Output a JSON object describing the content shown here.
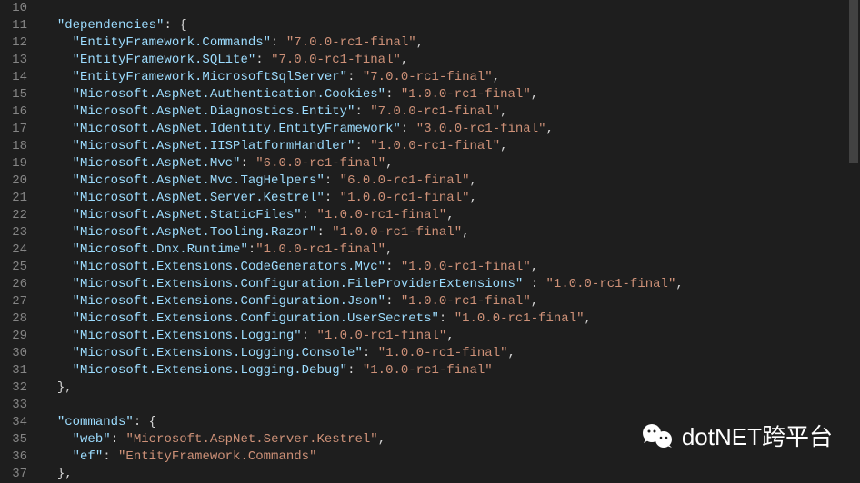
{
  "startLine": 10,
  "lines": [
    {
      "indent": 0,
      "tokens": []
    },
    {
      "indent": 1,
      "tokens": [
        {
          "t": "key",
          "v": "\"dependencies\""
        },
        {
          "t": "punctuation",
          "v": ": {"
        }
      ]
    },
    {
      "indent": 2,
      "tokens": [
        {
          "t": "key",
          "v": "\"EntityFramework.Commands\""
        },
        {
          "t": "punctuation",
          "v": ": "
        },
        {
          "t": "string",
          "v": "\"7.0.0-rc1-final\""
        },
        {
          "t": "punctuation",
          "v": ","
        }
      ]
    },
    {
      "indent": 2,
      "tokens": [
        {
          "t": "key",
          "v": "\"EntityFramework.SQLite\""
        },
        {
          "t": "punctuation",
          "v": ": "
        },
        {
          "t": "string",
          "v": "\"7.0.0-rc1-final\""
        },
        {
          "t": "punctuation",
          "v": ","
        }
      ]
    },
    {
      "indent": 2,
      "tokens": [
        {
          "t": "key",
          "v": "\"EntityFramework.MicrosoftSqlServer\""
        },
        {
          "t": "punctuation",
          "v": ": "
        },
        {
          "t": "string",
          "v": "\"7.0.0-rc1-final\""
        },
        {
          "t": "punctuation",
          "v": ","
        }
      ]
    },
    {
      "indent": 2,
      "tokens": [
        {
          "t": "key",
          "v": "\"Microsoft.AspNet.Authentication.Cookies\""
        },
        {
          "t": "punctuation",
          "v": ": "
        },
        {
          "t": "string",
          "v": "\"1.0.0-rc1-final\""
        },
        {
          "t": "punctuation",
          "v": ","
        }
      ]
    },
    {
      "indent": 2,
      "tokens": [
        {
          "t": "key",
          "v": "\"Microsoft.AspNet.Diagnostics.Entity\""
        },
        {
          "t": "punctuation",
          "v": ": "
        },
        {
          "t": "string",
          "v": "\"7.0.0-rc1-final\""
        },
        {
          "t": "punctuation",
          "v": ","
        }
      ]
    },
    {
      "indent": 2,
      "tokens": [
        {
          "t": "key",
          "v": "\"Microsoft.AspNet.Identity.EntityFramework\""
        },
        {
          "t": "punctuation",
          "v": ": "
        },
        {
          "t": "string",
          "v": "\"3.0.0-rc1-final\""
        },
        {
          "t": "punctuation",
          "v": ","
        }
      ]
    },
    {
      "indent": 2,
      "tokens": [
        {
          "t": "key",
          "v": "\"Microsoft.AspNet.IISPlatformHandler\""
        },
        {
          "t": "punctuation",
          "v": ": "
        },
        {
          "t": "string",
          "v": "\"1.0.0-rc1-final\""
        },
        {
          "t": "punctuation",
          "v": ","
        }
      ]
    },
    {
      "indent": 2,
      "tokens": [
        {
          "t": "key",
          "v": "\"Microsoft.AspNet.Mvc\""
        },
        {
          "t": "punctuation",
          "v": ": "
        },
        {
          "t": "string",
          "v": "\"6.0.0-rc1-final\""
        },
        {
          "t": "punctuation",
          "v": ","
        }
      ]
    },
    {
      "indent": 2,
      "tokens": [
        {
          "t": "key",
          "v": "\"Microsoft.AspNet.Mvc.TagHelpers\""
        },
        {
          "t": "punctuation",
          "v": ": "
        },
        {
          "t": "string",
          "v": "\"6.0.0-rc1-final\""
        },
        {
          "t": "punctuation",
          "v": ","
        }
      ]
    },
    {
      "indent": 2,
      "tokens": [
        {
          "t": "key",
          "v": "\"Microsoft.AspNet.Server.Kestrel\""
        },
        {
          "t": "punctuation",
          "v": ": "
        },
        {
          "t": "string",
          "v": "\"1.0.0-rc1-final\""
        },
        {
          "t": "punctuation",
          "v": ","
        }
      ]
    },
    {
      "indent": 2,
      "tokens": [
        {
          "t": "key",
          "v": "\"Microsoft.AspNet.StaticFiles\""
        },
        {
          "t": "punctuation",
          "v": ": "
        },
        {
          "t": "string",
          "v": "\"1.0.0-rc1-final\""
        },
        {
          "t": "punctuation",
          "v": ","
        }
      ]
    },
    {
      "indent": 2,
      "tokens": [
        {
          "t": "key",
          "v": "\"Microsoft.AspNet.Tooling.Razor\""
        },
        {
          "t": "punctuation",
          "v": ": "
        },
        {
          "t": "string",
          "v": "\"1.0.0-rc1-final\""
        },
        {
          "t": "punctuation",
          "v": ","
        }
      ]
    },
    {
      "indent": 2,
      "tokens": [
        {
          "t": "key",
          "v": "\"Microsoft.Dnx.Runtime\""
        },
        {
          "t": "punctuation",
          "v": ":"
        },
        {
          "t": "string",
          "v": "\"1.0.0-rc1-final\""
        },
        {
          "t": "punctuation",
          "v": ","
        }
      ]
    },
    {
      "indent": 2,
      "tokens": [
        {
          "t": "key",
          "v": "\"Microsoft.Extensions.CodeGenerators.Mvc\""
        },
        {
          "t": "punctuation",
          "v": ": "
        },
        {
          "t": "string",
          "v": "\"1.0.0-rc1-final\""
        },
        {
          "t": "punctuation",
          "v": ","
        }
      ]
    },
    {
      "indent": 2,
      "tokens": [
        {
          "t": "key",
          "v": "\"Microsoft.Extensions.Configuration.FileProviderExtensions\""
        },
        {
          "t": "punctuation",
          "v": " : "
        },
        {
          "t": "string",
          "v": "\"1.0.0-rc1-final\""
        },
        {
          "t": "punctuation",
          "v": ","
        }
      ]
    },
    {
      "indent": 2,
      "tokens": [
        {
          "t": "key",
          "v": "\"Microsoft.Extensions.Configuration.Json\""
        },
        {
          "t": "punctuation",
          "v": ": "
        },
        {
          "t": "string",
          "v": "\"1.0.0-rc1-final\""
        },
        {
          "t": "punctuation",
          "v": ","
        }
      ]
    },
    {
      "indent": 2,
      "tokens": [
        {
          "t": "key",
          "v": "\"Microsoft.Extensions.Configuration.UserSecrets\""
        },
        {
          "t": "punctuation",
          "v": ": "
        },
        {
          "t": "string",
          "v": "\"1.0.0-rc1-final\""
        },
        {
          "t": "punctuation",
          "v": ","
        }
      ]
    },
    {
      "indent": 2,
      "tokens": [
        {
          "t": "key",
          "v": "\"Microsoft.Extensions.Logging\""
        },
        {
          "t": "punctuation",
          "v": ": "
        },
        {
          "t": "string",
          "v": "\"1.0.0-rc1-final\""
        },
        {
          "t": "punctuation",
          "v": ","
        }
      ]
    },
    {
      "indent": 2,
      "tokens": [
        {
          "t": "key",
          "v": "\"Microsoft.Extensions.Logging.Console\""
        },
        {
          "t": "punctuation",
          "v": ": "
        },
        {
          "t": "string",
          "v": "\"1.0.0-rc1-final\""
        },
        {
          "t": "punctuation",
          "v": ","
        }
      ]
    },
    {
      "indent": 2,
      "tokens": [
        {
          "t": "key",
          "v": "\"Microsoft.Extensions.Logging.Debug\""
        },
        {
          "t": "punctuation",
          "v": ": "
        },
        {
          "t": "string",
          "v": "\"1.0.0-rc1-final\""
        }
      ]
    },
    {
      "indent": 1,
      "tokens": [
        {
          "t": "punctuation",
          "v": "},"
        }
      ]
    },
    {
      "indent": 0,
      "tokens": []
    },
    {
      "indent": 1,
      "tokens": [
        {
          "t": "key",
          "v": "\"commands\""
        },
        {
          "t": "punctuation",
          "v": ": {"
        }
      ]
    },
    {
      "indent": 2,
      "tokens": [
        {
          "t": "key",
          "v": "\"web\""
        },
        {
          "t": "punctuation",
          "v": ": "
        },
        {
          "t": "string",
          "v": "\"Microsoft.AspNet.Server.Kestrel\""
        },
        {
          "t": "punctuation",
          "v": ","
        }
      ]
    },
    {
      "indent": 2,
      "tokens": [
        {
          "t": "key",
          "v": "\"ef\""
        },
        {
          "t": "punctuation",
          "v": ": "
        },
        {
          "t": "string",
          "v": "\"EntityFramework.Commands\""
        }
      ]
    },
    {
      "indent": 1,
      "tokens": [
        {
          "t": "punctuation",
          "v": "},"
        }
      ]
    }
  ],
  "watermark": {
    "text": "dotNET跨平台"
  }
}
